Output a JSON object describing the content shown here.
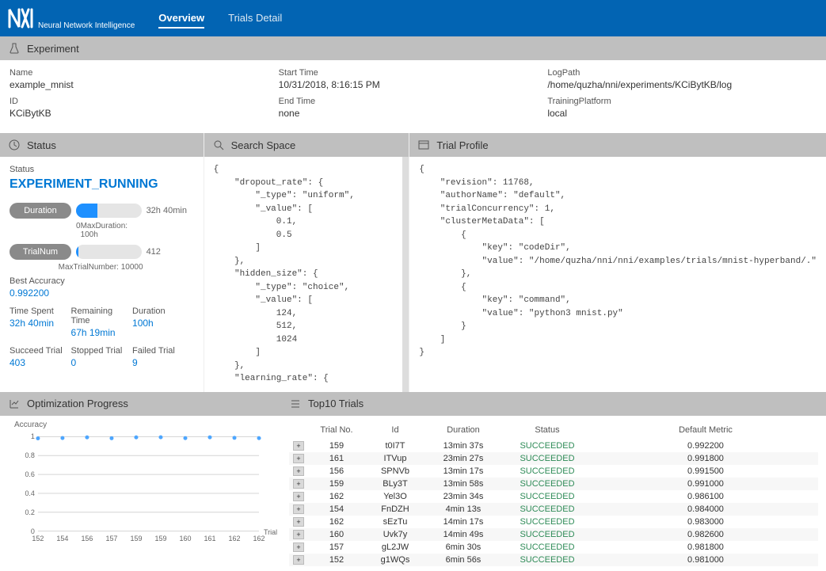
{
  "header": {
    "brand_text": "Neural Network Intelligence",
    "tabs": {
      "overview": "Overview",
      "trials": "Trials Detail"
    }
  },
  "sections": {
    "experiment": "Experiment",
    "status": "Status",
    "search": "Search Space",
    "profile": "Trial Profile",
    "optimization": "Optimization Progress",
    "top10": "Top10 Trials"
  },
  "experiment": {
    "name_label": "Name",
    "name_value": "example_mnist",
    "id_label": "ID",
    "id_value": "KCiBytKB",
    "start_label": "Start Time",
    "start_value": "10/31/2018, 8:16:15 PM",
    "end_label": "End Time",
    "end_value": "none",
    "log_label": "LogPath",
    "log_value": "/home/quzha/nni/experiments/KCiBytKB/log",
    "platform_label": "TrainingPlatform",
    "platform_value": "local"
  },
  "status": {
    "label": "Status",
    "value": "EXPERIMENT_RUNNING",
    "duration_label": "Duration",
    "duration_text": "32h 40min",
    "duration_sub_zero": "0",
    "duration_sub": "MaxDuration: 100h",
    "trialnum_label": "TrialNum",
    "trialnum_text": "412",
    "trialnum_sub": "MaxTrialNumber: 10000",
    "best_label": "Best Accuracy",
    "best_value": "0.992200",
    "time_spent_label": "Time Spent",
    "time_spent": "32h 40min",
    "remaining_label": "Remaining Time",
    "remaining": "67h 19min",
    "dur_label": "Duration",
    "dur_val": "100h",
    "succeed_label": "Succeed Trial",
    "succeed": "403",
    "stopped_label": "Stopped Trial",
    "stopped": "0",
    "failed_label": "Failed Trial",
    "failed": "9"
  },
  "search_space": "{\n    \"dropout_rate\": {\n        \"_type\": \"uniform\",\n        \"_value\": [\n            0.1,\n            0.5\n        ]\n    },\n    \"hidden_size\": {\n        \"_type\": \"choice\",\n        \"_value\": [\n            124,\n            512,\n            1024\n        ]\n    },\n    \"learning_rate\": {",
  "trial_profile": "{\n    \"revision\": 11768,\n    \"authorName\": \"default\",\n    \"trialConcurrency\": 1,\n    \"clusterMetaData\": [\n        {\n            \"key\": \"codeDir\",\n            \"value\": \"/home/quzha/nni/nni/examples/trials/mnist-hyperband/.\"\n        },\n        {\n            \"key\": \"command\",\n            \"value\": \"python3 mnist.py\"\n        }\n    ]\n}",
  "chart_data": {
    "type": "scatter",
    "title": "",
    "xlabel": "Trial",
    "ylabel": "Accuracy",
    "ylim": [
      0,
      1
    ],
    "yticks": [
      0,
      0.2,
      0.4,
      0.6,
      0.8,
      1
    ],
    "x": [
      152,
      154,
      156,
      157,
      159,
      159,
      160,
      161,
      162,
      162
    ],
    "y": [
      0.981,
      0.984,
      0.9915,
      0.9818,
      0.991,
      0.9922,
      0.9826,
      0.9918,
      0.9861,
      0.983
    ],
    "xticks": [
      152,
      154,
      156,
      157,
      159,
      159,
      160,
      161,
      162,
      162
    ]
  },
  "top10": {
    "headers": {
      "trial": "Trial No.",
      "id": "Id",
      "duration": "Duration",
      "status": "Status",
      "metric": "Default Metric"
    },
    "rows": [
      {
        "trial": "159",
        "id": "t0I7T",
        "duration": "13min 37s",
        "status": "SUCCEEDED",
        "metric": "0.992200"
      },
      {
        "trial": "161",
        "id": "ITVup",
        "duration": "23min 27s",
        "status": "SUCCEEDED",
        "metric": "0.991800"
      },
      {
        "trial": "156",
        "id": "SPNVb",
        "duration": "13min 17s",
        "status": "SUCCEEDED",
        "metric": "0.991500"
      },
      {
        "trial": "159",
        "id": "BLy3T",
        "duration": "13min 58s",
        "status": "SUCCEEDED",
        "metric": "0.991000"
      },
      {
        "trial": "162",
        "id": "Yel3O",
        "duration": "23min 34s",
        "status": "SUCCEEDED",
        "metric": "0.986100"
      },
      {
        "trial": "154",
        "id": "FnDZH",
        "duration": "4min 13s",
        "status": "SUCCEEDED",
        "metric": "0.984000"
      },
      {
        "trial": "162",
        "id": "sEzTu",
        "duration": "14min 17s",
        "status": "SUCCEEDED",
        "metric": "0.983000"
      },
      {
        "trial": "160",
        "id": "Uvk7y",
        "duration": "14min 49s",
        "status": "SUCCEEDED",
        "metric": "0.982600"
      },
      {
        "trial": "157",
        "id": "gL2JW",
        "duration": "6min 30s",
        "status": "SUCCEEDED",
        "metric": "0.981800"
      },
      {
        "trial": "152",
        "id": "g1WQs",
        "duration": "6min 56s",
        "status": "SUCCEEDED",
        "metric": "0.981000"
      }
    ]
  }
}
